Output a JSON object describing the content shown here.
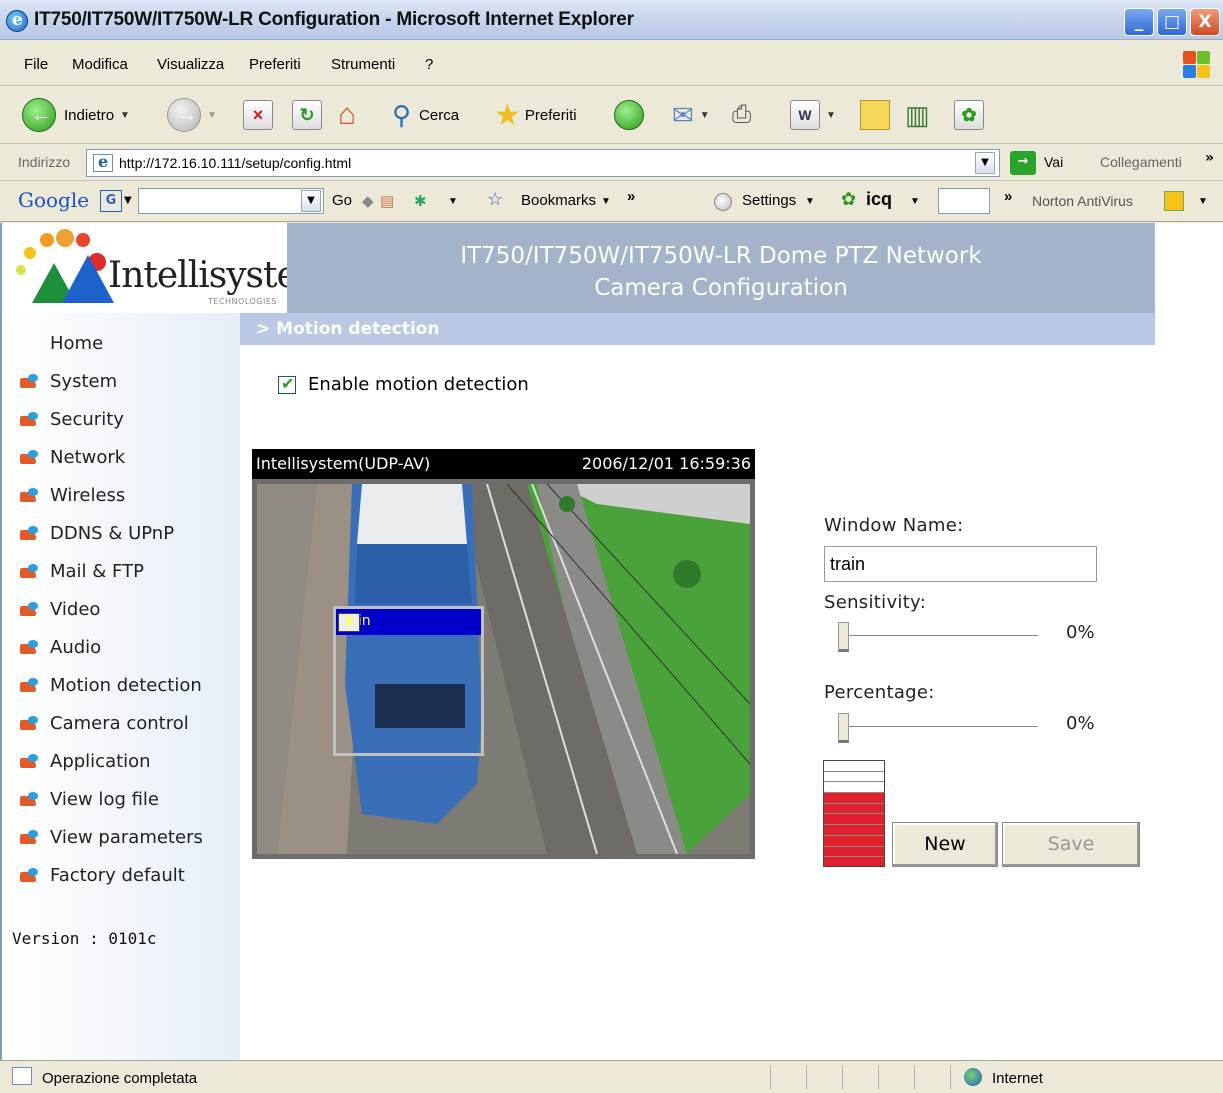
{
  "window": {
    "title": "IT750/IT750W/IT750W-LR Configuration - Microsoft Internet Explorer",
    "min_label": "_",
    "max_label": "□",
    "close_label": "X"
  },
  "menu": [
    "File",
    "Modifica",
    "Visualizza",
    "Preferiti",
    "Strumenti",
    "?"
  ],
  "toolbar": {
    "back_label": "Indietro",
    "search_label": "Cerca",
    "favorites_label": "Preferiti"
  },
  "address": {
    "label": "Indirizzo",
    "url": "http://172.16.10.111/setup/config.html",
    "go_label": "Vai",
    "links_label": "Collegamenti"
  },
  "google_bar": {
    "logo": "Google",
    "go_label": "Go",
    "bookmarks_label": "Bookmarks",
    "settings_label": "Settings",
    "icq_label": "icq",
    "norton_label": "Norton AntiVirus"
  },
  "header": {
    "logo_text": "Intellisystem",
    "logo_sub": "TECHNOLOGIES",
    "title_line1": "IT750/IT750W/IT750W-LR Dome PTZ Network",
    "title_line2": "Camera Configuration",
    "section": "> Motion detection"
  },
  "sidebar": {
    "items": [
      {
        "label": "Home"
      },
      {
        "label": "System"
      },
      {
        "label": "Security"
      },
      {
        "label": "Network"
      },
      {
        "label": "Wireless"
      },
      {
        "label": "DDNS & UPnP"
      },
      {
        "label": "Mail & FTP"
      },
      {
        "label": "Video"
      },
      {
        "label": "Audio"
      },
      {
        "label": "Motion detection"
      },
      {
        "label": "Camera control"
      },
      {
        "label": "Application"
      },
      {
        "label": "View log file"
      },
      {
        "label": "View parameters"
      },
      {
        "label": "Factory default"
      }
    ],
    "version": "Version : 0101c"
  },
  "motion": {
    "enable_label": "Enable motion detection",
    "enabled": true,
    "video_source": "Intellisystem(UDP-AV)",
    "video_timestamp": "2006/12/01 16:59:36",
    "window_title": "train",
    "window_close": "X",
    "window_name_label": "Window Name:",
    "window_name_value": "train",
    "sensitivity_label": "Sensitivity:",
    "sensitivity_value": "0%",
    "percentage_label": "Percentage:",
    "percentage_value": "0%",
    "meter_level": 0.7,
    "new_label": "New",
    "save_label": "Save"
  },
  "status": {
    "text": "Operazione completata",
    "zone": "Internet"
  },
  "colors": {
    "header_band": "#a2b3ca",
    "section_bar": "#b9c9e3",
    "meter_red": "#e0202a"
  }
}
